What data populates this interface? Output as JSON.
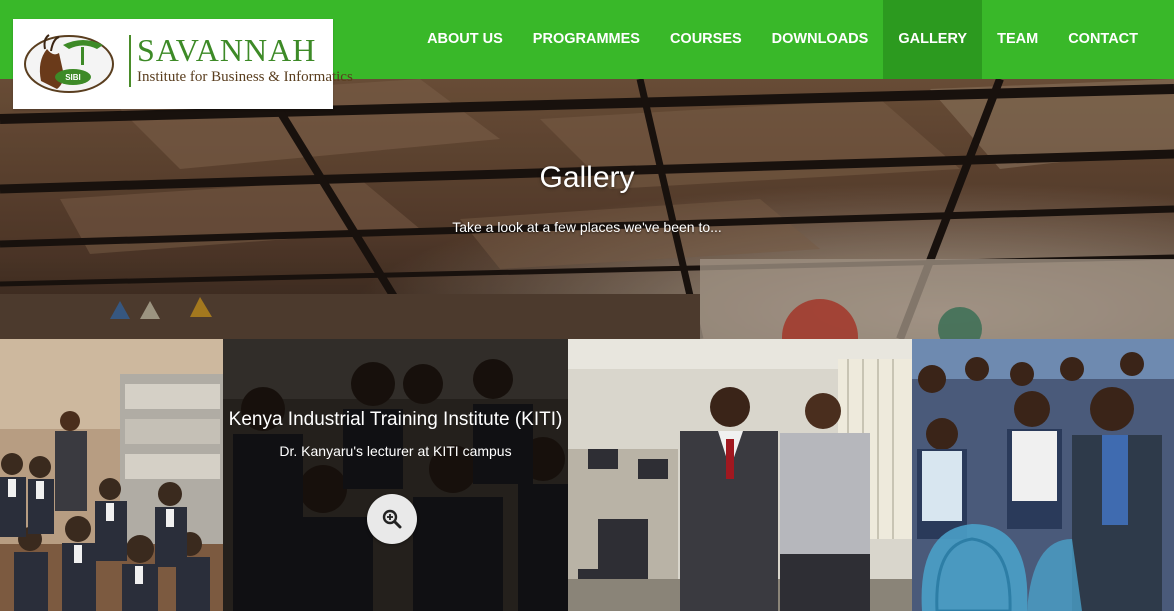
{
  "brand": {
    "name": "SAVANNAH",
    "tagline": "Institute for Business & Informatics",
    "emblem_text": "SIBI",
    "colors": {
      "green": "#39b829",
      "green_active": "#2c9a1f",
      "logo_green": "#3d8a27"
    }
  },
  "nav": {
    "items": [
      {
        "label": "ABOUT US"
      },
      {
        "label": "PROGRAMMES"
      },
      {
        "label": "COURSES"
      },
      {
        "label": "DOWNLOADS"
      },
      {
        "label": "GALLERY",
        "active": true
      },
      {
        "label": "TEAM"
      },
      {
        "label": "CONTACT"
      }
    ]
  },
  "hero": {
    "title": "Gallery",
    "subtitle": "Take a look at a few places we've been to..."
  },
  "gallery": {
    "items": [
      {
        "scene": "classroom-students"
      },
      {
        "title": "Kenya Industrial Training Institute (KITI)",
        "subtitle": "Dr. Kanyaru's lecturer at KITI campus",
        "hovered": true,
        "icon": "zoom-in-icon"
      },
      {
        "scene": "two-men-computer-lab"
      },
      {
        "scene": "students-blue-chairs"
      }
    ]
  }
}
